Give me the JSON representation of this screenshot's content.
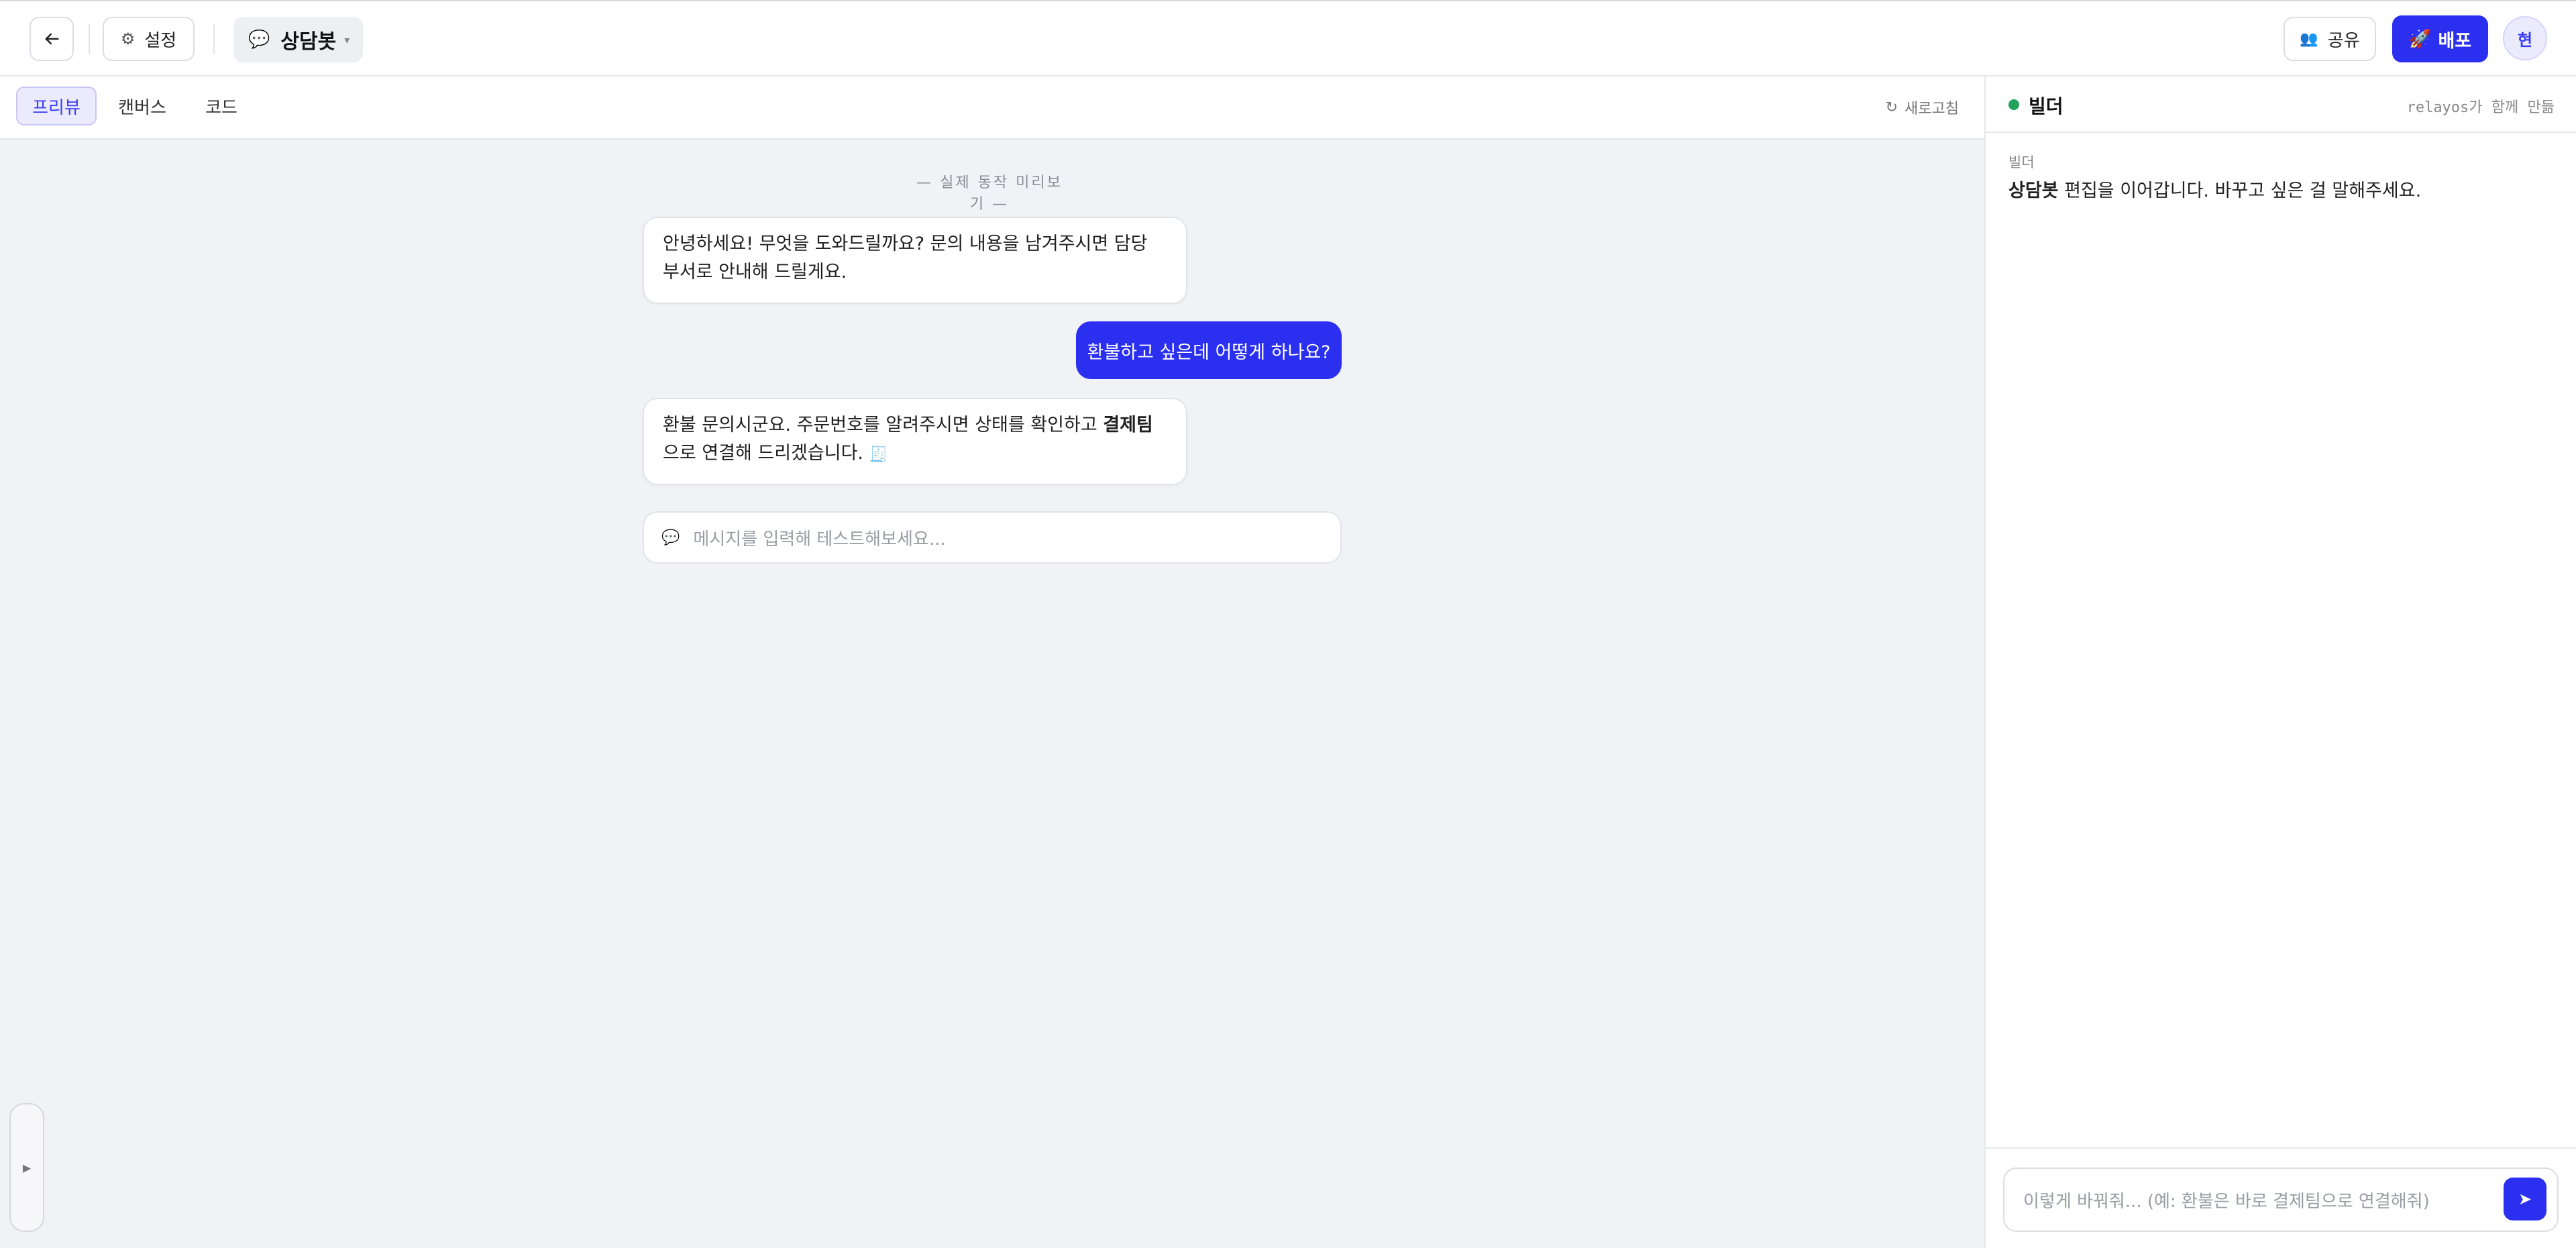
{
  "header": {
    "settings_label": "설정",
    "bot_name": "상담봇",
    "share_label": "공유",
    "deploy_label": "배포",
    "avatar_initial": "현"
  },
  "preview": {
    "tabs": [
      {
        "label": "프리뷰",
        "active": true
      },
      {
        "label": "캔버스",
        "active": false
      },
      {
        "label": "코드",
        "active": false
      }
    ],
    "refresh_label": "새로고침",
    "live_label": "— 실제 동작 미리보기 —",
    "messages": [
      {
        "role": "bot",
        "text": "안녕하세요! 무엇을 도와드릴까요? 문의 내용을 남겨주시면 담당 부서로 안내해 드릴게요."
      },
      {
        "role": "user",
        "text": "환불하고 싶은데 어떻게 하나요?"
      },
      {
        "role": "bot",
        "text_before": "환불 문의시군요. 주문번호를 알려주시면 상태를 확인하고 ",
        "text_bold": "결제팀",
        "text_after": "으로 연결해 드리겠습니다."
      }
    ],
    "input_placeholder": "메시지를 입력해 테스트해보세요..."
  },
  "builder": {
    "title": "빌더",
    "credit": "relayos가 함께 만듦",
    "sender": "빌더",
    "message_bold": "상담봇",
    "message_rest": " 편집을 이어갑니다. 바꾸고 싶은 걸 말해주세요.",
    "input_placeholder": "이렇게 바꿔줘... (예: 환불은 바로 결제팀으로 연결해줘)"
  },
  "colors": {
    "accent": "#2b2ff0",
    "status_online": "#22a35a",
    "canvas_bg": "#f1f2f6"
  }
}
